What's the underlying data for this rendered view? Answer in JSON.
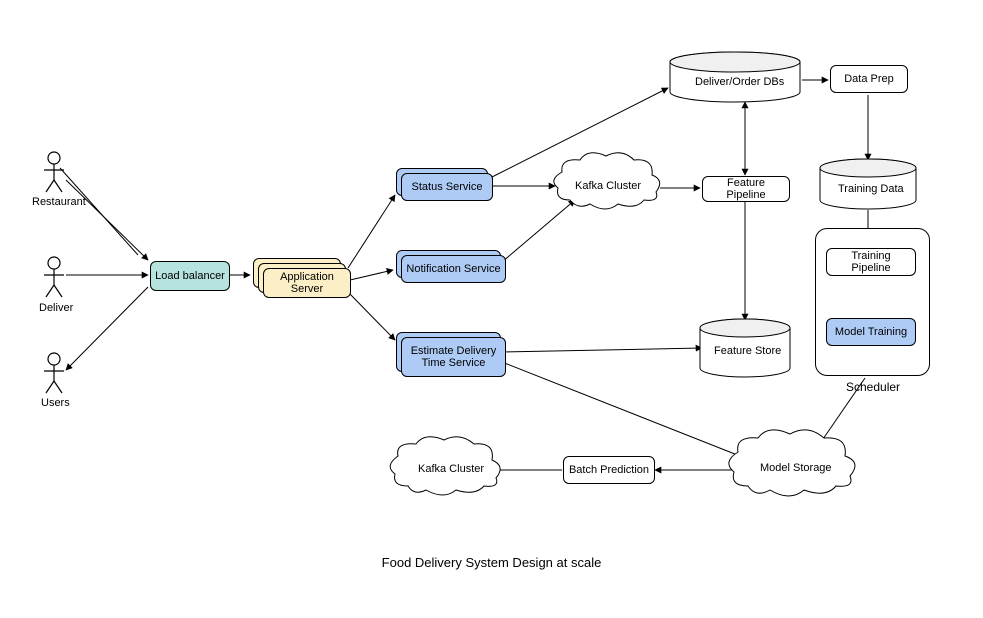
{
  "title": "Food Delivery System Design at scale",
  "actors": {
    "restaurant": "Restaurant",
    "deliver": "Deliver",
    "users": "Users"
  },
  "nodes": {
    "load_balancer": "Load balancer",
    "app_server": "Application Server",
    "status_service": "Status Service",
    "notification_service": "Notification Service",
    "estimate_service": "Estimate Delivery\nTime Service",
    "kafka_cluster_1": "Kafka Cluster",
    "kafka_cluster_2": "Kafka Cluster",
    "deliver_order_dbs": "Deliver/Order DBs",
    "data_prep": "Data Prep",
    "feature_pipeline": "Feature Pipeline",
    "training_data": "Training Data",
    "training_pipeline": "Training Pipeline",
    "model_training": "Model Training",
    "scheduler": "Scheduler",
    "feature_store": "Feature Store",
    "model_storage": "Model Storage",
    "batch_prediction": "Batch Prediction"
  },
  "colors": {
    "teal": "#B6E3DE",
    "yellow": "#FCEFC7",
    "blue": "#AECBF5",
    "white": "#ffffff",
    "stroke": "#000000"
  }
}
